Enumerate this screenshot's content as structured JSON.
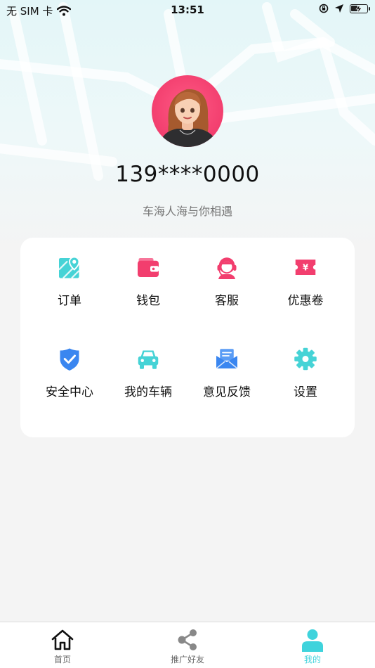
{
  "status_bar": {
    "carrier": "无 SIM 卡",
    "time": "13:51"
  },
  "profile": {
    "phone": "139****0000",
    "slogan": "车海人海与你相遇"
  },
  "menu": {
    "items": [
      {
        "label": "订单",
        "icon": "map-icon",
        "color": "#46d3d6"
      },
      {
        "label": "钱包",
        "icon": "wallet-icon",
        "color": "#f23e6e"
      },
      {
        "label": "客服",
        "icon": "customer-service-icon",
        "color": "#f23e6e"
      },
      {
        "label": "优惠卷",
        "icon": "coupon-icon",
        "color": "#f23e6e"
      },
      {
        "label": "安全中心",
        "icon": "shield-icon",
        "color": "#3a86f0"
      },
      {
        "label": "我的车辆",
        "icon": "car-icon",
        "color": "#46d3d6"
      },
      {
        "label": "意见反馈",
        "icon": "mail-icon",
        "color": "#3a86f0"
      },
      {
        "label": "设置",
        "icon": "gear-icon",
        "color": "#46d3d6"
      }
    ]
  },
  "tabbar": {
    "items": [
      {
        "label": "首页",
        "icon": "home-icon"
      },
      {
        "label": "推广好友",
        "icon": "share-icon"
      },
      {
        "label": "我的",
        "icon": "user-icon",
        "active": true
      }
    ]
  },
  "colors": {
    "accent": "#3fd3dc",
    "pink": "#f23e6e",
    "blue": "#3a86f0",
    "teal": "#46d3d6"
  }
}
